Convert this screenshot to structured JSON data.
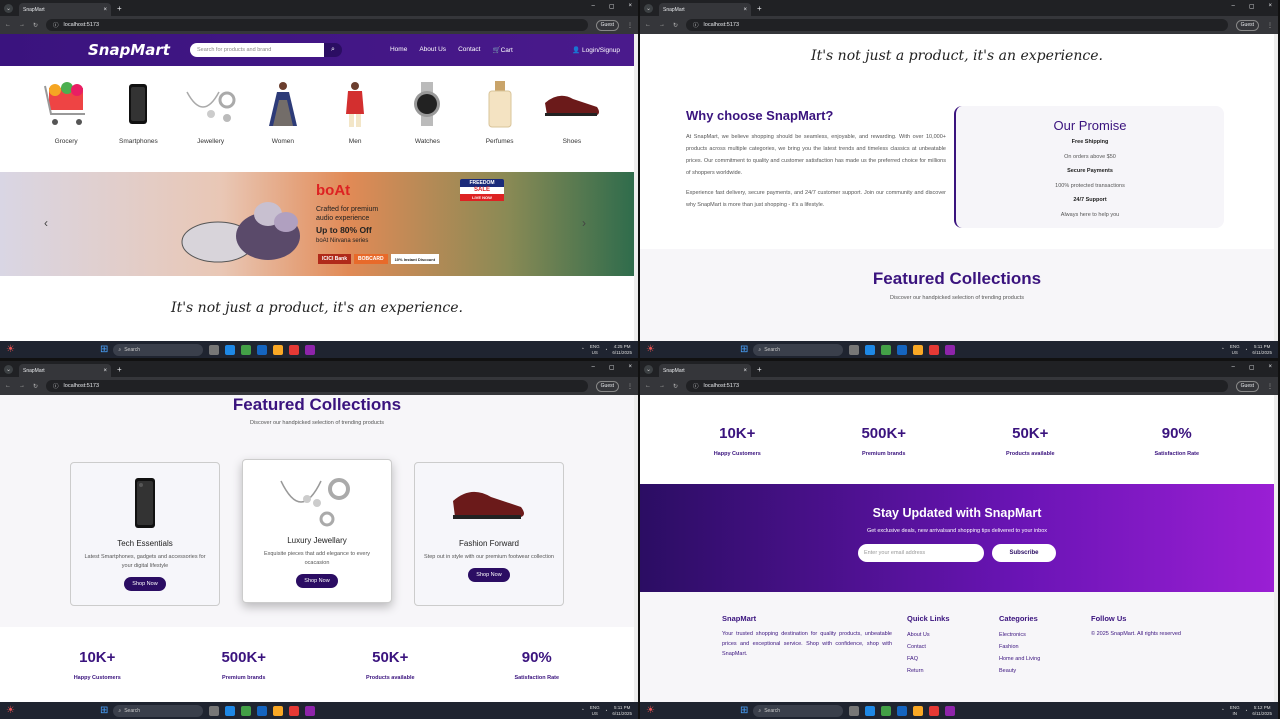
{
  "browser": {
    "tab_title": "SnapMart",
    "url": "localhost:5173",
    "guest": "Guest"
  },
  "site": {
    "logo": "SnapMart",
    "search_placeholder": "Search for products and brand",
    "nav": [
      "Home",
      "About Us",
      "Contact",
      "Cart"
    ],
    "login": "Login/Signup",
    "categories": [
      "Grocery",
      "Smartphones",
      "Jewellery",
      "Women",
      "Men",
      "Watches",
      "Perfumes",
      "Shoes"
    ],
    "banner": {
      "brand": "boAt",
      "line1": "Crafted for premium",
      "line2": "audio experience",
      "offer": "Up to 80% Off",
      "product": "boAt Nirvana series",
      "sale_top": "FREEDOM",
      "sale_mid": "SALE",
      "sale_bot": "LIVE NOW",
      "bank1": "ICICI Bank",
      "bank2": "BOBCARD",
      "bank3": "10% Instant Discount"
    },
    "tagline": "It's not just a product, it's an experience."
  },
  "why": {
    "title": "Why choose SnapMart?",
    "para1": "At SnapMart, we believe shopping should be seamless, enjoyable, and rewarding. With over 10,000+ products across multiple categories, we bring you the latest trends and timeless classics at unbeatable prices. Our commitment to quality and customer satisfaction has made us the preferred choice for millions of shoppers worldwide.",
    "para2": "Experience fast delivery, secure payments, and 24/7 customer support. Join our community and discover why SnapMart is more than just shopping - it's a lifestyle."
  },
  "promise": {
    "title": "Our Promise",
    "items": [
      {
        "title": "Free Shipping",
        "text": "On orders above $50"
      },
      {
        "title": "Secure Payments",
        "text": "100% protected transactions"
      },
      {
        "title": "24/7 Support",
        "text": "Always here to help you"
      }
    ]
  },
  "featured": {
    "title": "Featured Collections",
    "subtitle": "Discover our handpicked selection of trending products",
    "cards": [
      {
        "title": "Tech Essentials",
        "text": "Latest Smartphones, gadgets and accessories for your digital lifestyle",
        "button": "Shop Now"
      },
      {
        "title": "Luxury Jewellary",
        "text": "Exquisite pieces that add elegance to every ocacasion",
        "button": "Shop Now"
      },
      {
        "title": "Fashion Forward",
        "text": "Step out in style with our premium footwear collection",
        "button": "Shop Now"
      }
    ]
  },
  "stats": [
    {
      "value": "10K+",
      "label": "Happy Customers"
    },
    {
      "value": "500K+",
      "label": "Premium brands"
    },
    {
      "value": "50K+",
      "label": "Products available"
    },
    {
      "value": "90%",
      "label": "Satisfaction Rate"
    }
  ],
  "newsletter": {
    "title": "Stay Updated with SnapMart",
    "text": "Get exclusive deals, new arrivalsand shopping tips delivered to your inbox",
    "placeholder": "Enter your email address",
    "button": "Subscribe"
  },
  "footer": {
    "brand": "SnapMart",
    "desc": "Your trusted shopping destination for quality products, unbeatable prices and exceptional service. Shop with confidence, shop with SnapMart.",
    "quick_title": "Quick Links",
    "quick": [
      "About Us",
      "Contact",
      "FAQ",
      "Return"
    ],
    "cat_title": "Categories",
    "cats": [
      "Electronics",
      "Fashion",
      "Home and Living",
      "Beauty"
    ],
    "follow_title": "Follow Us",
    "copyright": "© 2025 SnapMart. All rights reserved"
  },
  "taskbar": {
    "search": "Search",
    "lang1": "ENG",
    "lang2a": "US",
    "lang2b": "IN",
    "time1": "4:25 PM",
    "time2": "5:11 PM",
    "time3": "5:11 PM",
    "time4": "5:12 PM",
    "date": "6/11/2025"
  }
}
